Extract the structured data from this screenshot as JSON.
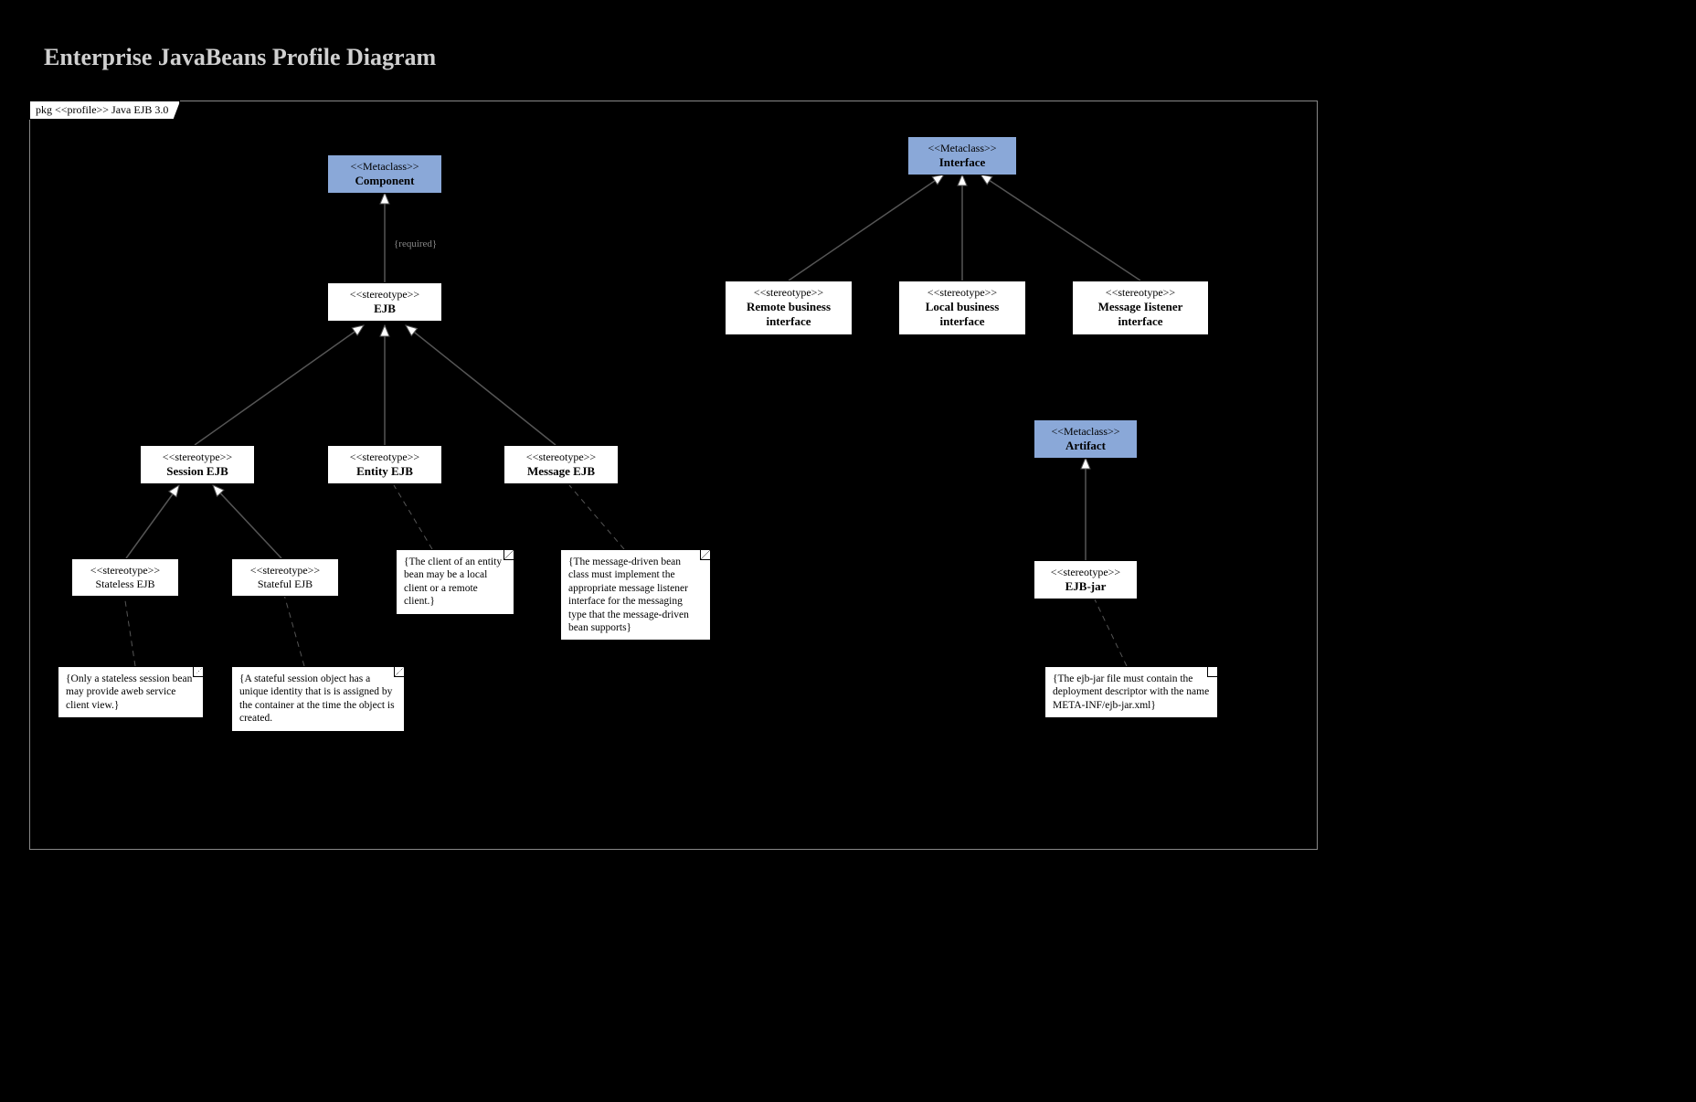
{
  "title": "Enterprise JavaBeans Profile Diagram",
  "frame_label": "pkg <<profile>> Java EJB 3.0",
  "required_label": "{required}",
  "component": {
    "stereo": "<<Metaclass>>",
    "name": "Component"
  },
  "ejb": {
    "stereo": "<<stereotype>>",
    "name": "EJB"
  },
  "session": {
    "stereo": "<<stereotype>>",
    "name": "Session EJB"
  },
  "entity": {
    "stereo": "<<stereotype>>",
    "name": "Entity EJB"
  },
  "message": {
    "stereo": "<<stereotype>>",
    "name": "Message EJB"
  },
  "stateless": {
    "stereo": "<<stereotype>>",
    "name": "Stateless EJB"
  },
  "stateful": {
    "stereo": "<<stereotype>>",
    "name": "Stateful EJB"
  },
  "interface": {
    "stereo": "<<Metaclass>>",
    "name": "Interface"
  },
  "remote": {
    "stereo": "<<stereotype>>",
    "name": "Remote business interface"
  },
  "local": {
    "stereo": "<<stereotype>>",
    "name": "Local business interface"
  },
  "listener": {
    "stereo": "<<stereotype>>",
    "name": "Message Iistener interface"
  },
  "artifact": {
    "stereo": "<<Metaclass>>",
    "name": "Artifact"
  },
  "ejbjar": {
    "stereo": "<<stereotype>>",
    "name": "EJB-jar"
  },
  "note_stateless": "{Only a stateless session bean may provide aweb service client view.}",
  "note_stateful": "{A stateful session object has a unique identity that is is assigned by the container at the time the object is created.",
  "note_entity": "{The client of an entity bean may be a local client or a remote client.}",
  "note_message": "{The message-driven bean class must implement the appropriate message listener interface for the messaging type that the message-driven bean supports}",
  "note_ejbjar": "{The ejb-jar file must contain the deployment descriptor with the name META-INF/ejb-jar.xml}"
}
